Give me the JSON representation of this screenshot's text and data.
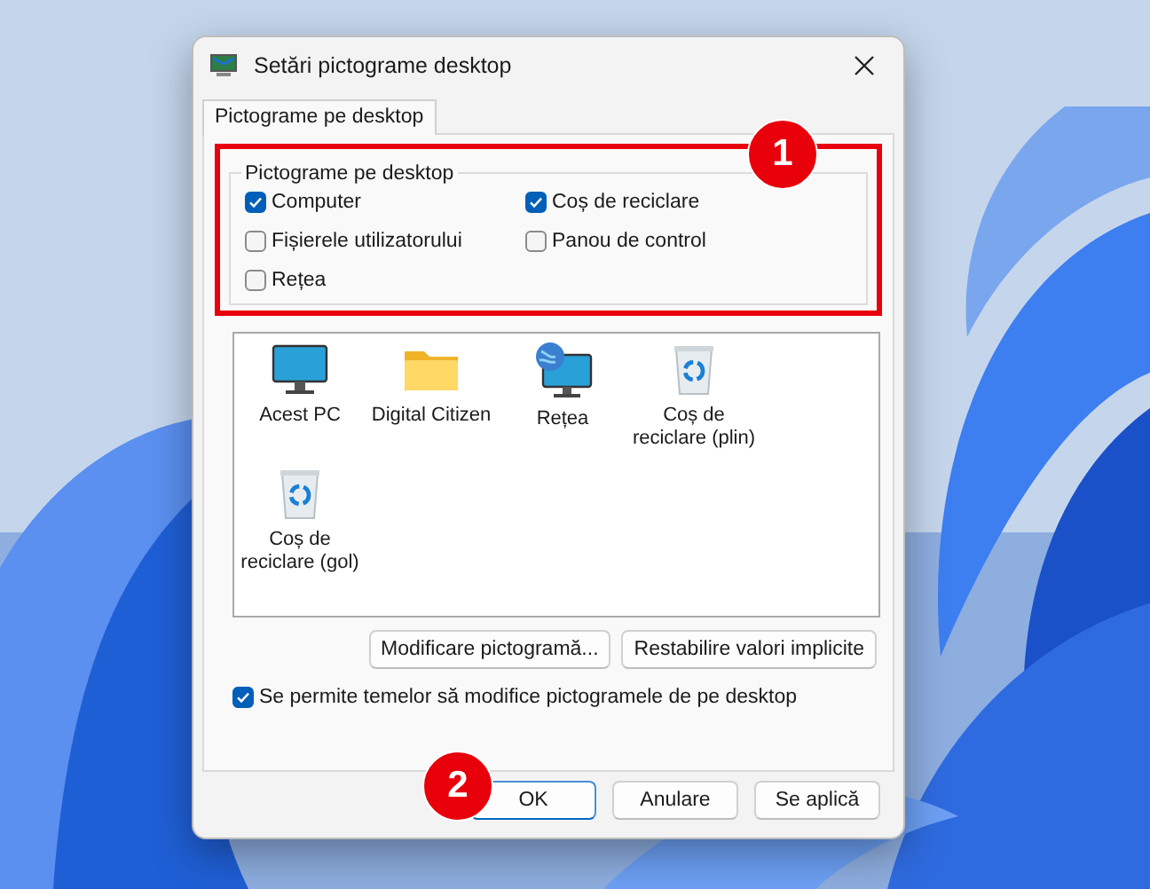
{
  "window": {
    "title": "Setări pictograme desktop"
  },
  "tabs": [
    {
      "label": "Pictograme pe desktop",
      "selected": true
    }
  ],
  "group": {
    "label": "Pictograme pe desktop",
    "highlighted": true,
    "checkboxes": [
      {
        "label": "Computer",
        "checked": true
      },
      {
        "label": "Coș de reciclare",
        "checked": true
      },
      {
        "label": "Fișierele utilizatorului",
        "checked": false
      },
      {
        "label": "Panou de control",
        "checked": false
      },
      {
        "label": "Rețea",
        "checked": false
      }
    ]
  },
  "icons": [
    {
      "label": "Acest PC",
      "kind": "monitor"
    },
    {
      "label": "Digital Citizen",
      "kind": "folder"
    },
    {
      "label": "Rețea",
      "kind": "network"
    },
    {
      "label": "Coș de reciclare (plin)",
      "kind": "bin"
    },
    {
      "label": "Coș de reciclare (gol)",
      "kind": "bin"
    }
  ],
  "icon_buttons": [
    "Modificare pictogramă...",
    "Restabilire valori implicite"
  ],
  "allow_themes": {
    "label": "Se permite temelor să modifice pictogramele de pe desktop",
    "checked": true
  },
  "dialog_buttons": [
    {
      "label": "OK",
      "default": true
    },
    {
      "label": "Anulare",
      "default": false
    },
    {
      "label": "Se aplică",
      "default": false
    }
  ],
  "callouts": [
    {
      "label": "1"
    },
    {
      "label": "2"
    }
  ]
}
